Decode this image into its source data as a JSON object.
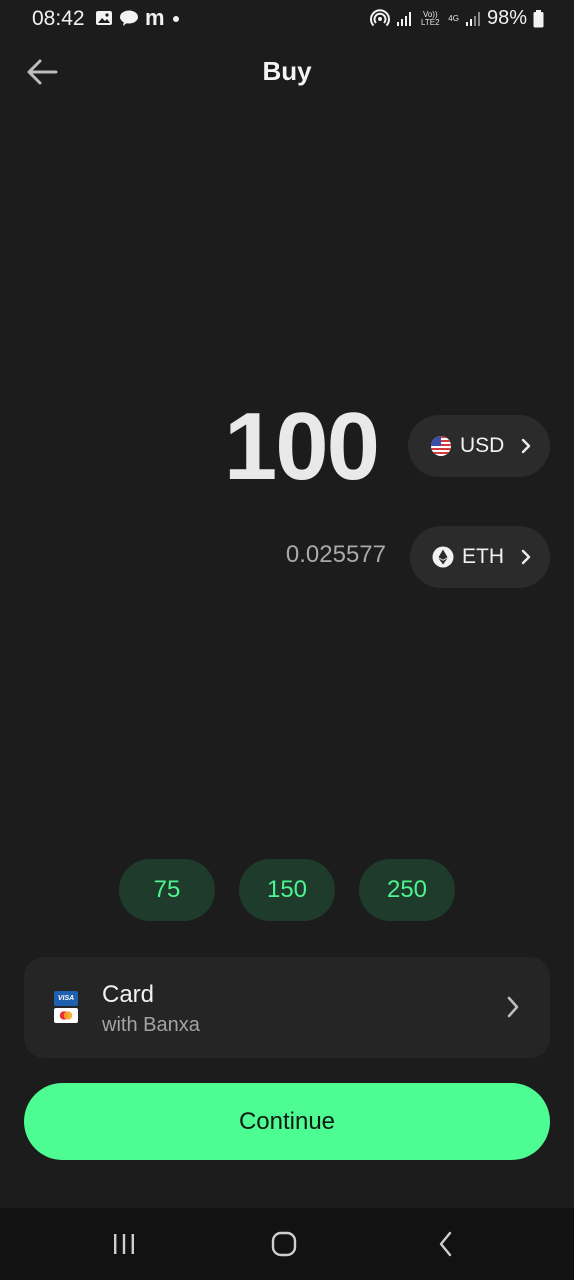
{
  "status_bar": {
    "time": "08:42",
    "left_icons": [
      "image-icon",
      "chat-bubble-icon",
      "m-app-icon",
      "dot-icon"
    ],
    "m_label": "m",
    "volte_label": "Vo)) LTE2",
    "network_label": "4G",
    "battery": "98%"
  },
  "header": {
    "title": "Buy"
  },
  "amount": {
    "value": "100",
    "fiat_currency": "USD",
    "crypto_value": "0.025577",
    "crypto_currency": "ETH"
  },
  "quick_amounts": [
    "75",
    "150",
    "250"
  ],
  "payment_method": {
    "title": "Card",
    "subtitle": "with Banxa",
    "visa_label": "VISA"
  },
  "continue_label": "Continue",
  "colors": {
    "background": "#1c1c1c",
    "accent": "#4dfd93",
    "quick_bg": "#1f3b2b",
    "quick_text": "#4cf58f",
    "pill_bg": "#2b2b2b",
    "card_bg": "#252525"
  }
}
